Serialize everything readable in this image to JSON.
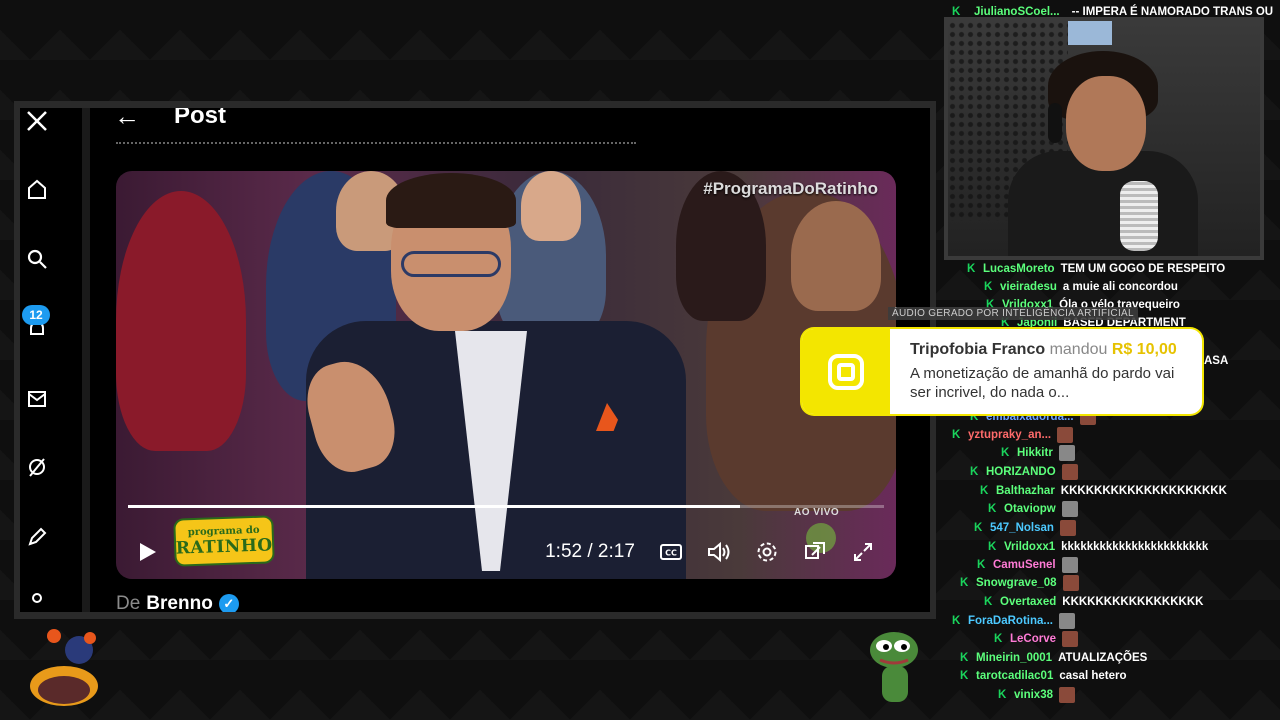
{
  "post": {
    "back_icon": "arrow-left-icon",
    "title": "Post",
    "byline_prefix": "De",
    "byline_name": "Brenno"
  },
  "sidebar": {
    "notification_count": "12",
    "icons": [
      "x-logo-icon",
      "home-icon",
      "search-icon",
      "notifications-icon",
      "messages-icon",
      "grok-icon",
      "compose-icon",
      "profile-icon"
    ]
  },
  "video": {
    "hashtag": "#ProgramaDoRatinho",
    "logo_line1": "programa do",
    "logo_line2": "RATINHO",
    "live_label": "AO VIVO",
    "time": "1:52 / 2:17",
    "progress": 0.81
  },
  "donation": {
    "ai_label": "ÁUDIO GERADO POR INTELIGÊNCIA ARTIFICIAL",
    "name": "Tripofobia Franco",
    "verb": "mandou",
    "amount": "R$ 10,00",
    "message": "A monetização de amanhã do pardo vai ser incrivel, do nada o...",
    "accent": "#f3e600"
  },
  "chat": {
    "top": {
      "user": "JiulianoSCoel...",
      "msg": "-- IMPERA É NAMORADO TRANS OU"
    },
    "lines": [
      {
        "user": "LucasMoreto",
        "msg": "TEM UM GOGO DE RESPEITO"
      },
      {
        "user": "vieiradesu",
        "msg": "a muie ali concordou"
      },
      {
        "user": "Vrildoxx1",
        "msg": "Óla o vélo travequeiro"
      },
      {
        "user": "Japonil",
        "msg": "BASED DEPARTMENT"
      },
      {
        "user": "",
        "msg": "ASA"
      },
      {
        "user": "embaixadorda...",
        "msg": ""
      },
      {
        "user": "yztupraky_an...",
        "msg": ""
      },
      {
        "user": "Hikkitr",
        "msg": ""
      },
      {
        "user": "HORIZANDO",
        "msg": ""
      },
      {
        "user": "Balthazhar",
        "msg": "KKKKKKKKKKKKKKKKKKKK"
      },
      {
        "user": "Otaviopw",
        "msg": ""
      },
      {
        "user": "547_Nolsan",
        "msg": ""
      },
      {
        "user": "Vrildoxx1",
        "msg": "kkkkkkkkkkkkkkkkkkkkkkk"
      },
      {
        "user": "CamuSenel",
        "msg": ""
      },
      {
        "user": "Snowgrave_08",
        "msg": ""
      },
      {
        "user": "Overtaxed",
        "msg": "KKKKKKKKKKKKKKKKK"
      },
      {
        "user": "ForaDaRotina...",
        "msg": ""
      },
      {
        "user": "LeCorve",
        "msg": ""
      },
      {
        "user": "Mineirin_0001",
        "msg": "ATUALIZAÇÕES"
      },
      {
        "user": "tarotcadilac01",
        "msg": "casal hetero"
      },
      {
        "user": "vinix38",
        "msg": ""
      }
    ]
  }
}
